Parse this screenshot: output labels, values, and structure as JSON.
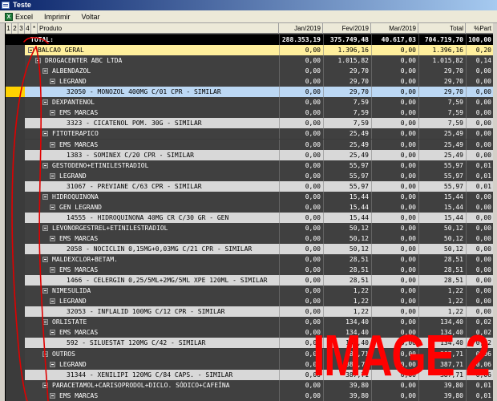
{
  "window": {
    "title": "Teste"
  },
  "menu": {
    "excel": "Excel",
    "imprimir": "Imprimir",
    "voltar": "Voltar",
    "excel_icon": "X"
  },
  "grid": {
    "levels": [
      "1",
      "2",
      "3",
      "4"
    ],
    "header": {
      "star": "*",
      "produto": "Produto",
      "jan": "Jan/2019",
      "fev": "Fev/2019",
      "mar": "Mar/2019",
      "total": "Total",
      "part": "%Part"
    },
    "rows": [
      {
        "type": "total",
        "indent": 0,
        "code": "",
        "label": "TOTAL:",
        "jan": "288.353,19",
        "fev": "375.749,48",
        "mar": "40.617,03",
        "total": "704.719,70",
        "part": "100,00"
      },
      {
        "type": "top",
        "indent": 0,
        "code": "",
        "label": "BALCAO GERAL",
        "jan": "0,00",
        "fev": "1.396,16",
        "mar": "0,00",
        "total": "1.396,16",
        "part": "0,20"
      },
      {
        "type": "group",
        "indent": 1,
        "code": "",
        "label": "DROGACENTER ABC LTDA",
        "jan": "0,00",
        "fev": "1.015,82",
        "mar": "0,00",
        "total": "1.015,82",
        "part": "0,14"
      },
      {
        "type": "group",
        "indent": 2,
        "code": "",
        "label": "ALBENDAZOL",
        "jan": "0,00",
        "fev": "29,70",
        "mar": "0,00",
        "total": "29,70",
        "part": "0,00"
      },
      {
        "type": "group",
        "indent": 3,
        "code": "",
        "label": "LEGRAND",
        "jan": "0,00",
        "fev": "29,70",
        "mar": "0,00",
        "total": "29,70",
        "part": "0,00"
      },
      {
        "type": "selected",
        "indent": 4,
        "code": "32050",
        "label": "- MONOZOL 400MG C/01 CPR - SIMILAR",
        "jan": "0,00",
        "fev": "29,70",
        "mar": "0,00",
        "total": "29,70",
        "part": "0,00"
      },
      {
        "type": "group",
        "indent": 2,
        "code": "",
        "label": "DEXPANTENOL",
        "jan": "0,00",
        "fev": "7,59",
        "mar": "0,00",
        "total": "7,59",
        "part": "0,00"
      },
      {
        "type": "group",
        "indent": 3,
        "code": "",
        "label": "EMS MARCAS",
        "jan": "0,00",
        "fev": "7,59",
        "mar": "0,00",
        "total": "7,59",
        "part": "0,00"
      },
      {
        "type": "product",
        "indent": 4,
        "code": "3323",
        "label": "- CICATENOL POM. 30G - SIMILAR",
        "jan": "0,00",
        "fev": "7,59",
        "mar": "0,00",
        "total": "7,59",
        "part": "0,00"
      },
      {
        "type": "group",
        "indent": 2,
        "code": "",
        "label": "FITOTERAPICO",
        "jan": "0,00",
        "fev": "25,49",
        "mar": "0,00",
        "total": "25,49",
        "part": "0,00"
      },
      {
        "type": "group",
        "indent": 3,
        "code": "",
        "label": "EMS MARCAS",
        "jan": "0,00",
        "fev": "25,49",
        "mar": "0,00",
        "total": "25,49",
        "part": "0,00"
      },
      {
        "type": "product",
        "indent": 4,
        "code": "1383",
        "label": "- SOMINEX C/20 CPR - SIMILAR",
        "jan": "0,00",
        "fev": "25,49",
        "mar": "0,00",
        "total": "25,49",
        "part": "0,00"
      },
      {
        "type": "group",
        "indent": 2,
        "code": "",
        "label": "GESTODENO+ETINILESTRADIOL",
        "jan": "0,00",
        "fev": "55,97",
        "mar": "0,00",
        "total": "55,97",
        "part": "0,01"
      },
      {
        "type": "group",
        "indent": 3,
        "code": "",
        "label": "LEGRAND",
        "jan": "0,00",
        "fev": "55,97",
        "mar": "0,00",
        "total": "55,97",
        "part": "0,01"
      },
      {
        "type": "product",
        "indent": 4,
        "code": "31067",
        "label": "- PREVIANE C/63 CPR - SIMILAR",
        "jan": "0,00",
        "fev": "55,97",
        "mar": "0,00",
        "total": "55,97",
        "part": "0,01"
      },
      {
        "type": "group",
        "indent": 2,
        "code": "",
        "label": "HIDROQUINONA",
        "jan": "0,00",
        "fev": "15,44",
        "mar": "0,00",
        "total": "15,44",
        "part": "0,00"
      },
      {
        "type": "group",
        "indent": 3,
        "code": "",
        "label": "GEN LEGRAND",
        "jan": "0,00",
        "fev": "15,44",
        "mar": "0,00",
        "total": "15,44",
        "part": "0,00"
      },
      {
        "type": "product",
        "indent": 4,
        "code": "14555",
        "label": "- HIDROQUINONA 40MG CR C/30 GR - GEN",
        "jan": "0,00",
        "fev": "15,44",
        "mar": "0,00",
        "total": "15,44",
        "part": "0,00"
      },
      {
        "type": "group",
        "indent": 2,
        "code": "",
        "label": "LEVONORGESTREL+ETINILESTRADIOL",
        "jan": "0,00",
        "fev": "50,12",
        "mar": "0,00",
        "total": "50,12",
        "part": "0,00"
      },
      {
        "type": "group",
        "indent": 3,
        "code": "",
        "label": "EMS MARCAS",
        "jan": "0,00",
        "fev": "50,12",
        "mar": "0,00",
        "total": "50,12",
        "part": "0,00"
      },
      {
        "type": "product",
        "indent": 4,
        "code": "2058",
        "label": "- NOCICLIN 0,15MG+0,03MG C/21 CPR - SIMILAR",
        "jan": "0,00",
        "fev": "50,12",
        "mar": "0,00",
        "total": "50,12",
        "part": "0,00"
      },
      {
        "type": "group",
        "indent": 2,
        "code": "",
        "label": "MALDEXCLOR+BETAM.",
        "jan": "0,00",
        "fev": "28,51",
        "mar": "0,00",
        "total": "28,51",
        "part": "0,00"
      },
      {
        "type": "group",
        "indent": 3,
        "code": "",
        "label": "EMS MARCAS",
        "jan": "0,00",
        "fev": "28,51",
        "mar": "0,00",
        "total": "28,51",
        "part": "0,00"
      },
      {
        "type": "product",
        "indent": 4,
        "code": "1466",
        "label": "- CELERGIN 0,25/5ML+2MG/5ML XPE 120ML - SIMILAR",
        "jan": "0,00",
        "fev": "28,51",
        "mar": "0,00",
        "total": "28,51",
        "part": "0,00"
      },
      {
        "type": "group",
        "indent": 2,
        "code": "",
        "label": "NIMESULIDA",
        "jan": "0,00",
        "fev": "1,22",
        "mar": "0,00",
        "total": "1,22",
        "part": "0,00"
      },
      {
        "type": "group",
        "indent": 3,
        "code": "",
        "label": "LEGRAND",
        "jan": "0,00",
        "fev": "1,22",
        "mar": "0,00",
        "total": "1,22",
        "part": "0,00"
      },
      {
        "type": "product",
        "indent": 4,
        "code": "32053",
        "label": "- INFLALID 100MG C/12 CPR - SIMILAR",
        "jan": "0,00",
        "fev": "1,22",
        "mar": "0,00",
        "total": "1,22",
        "part": "0,00"
      },
      {
        "type": "group",
        "indent": 2,
        "code": "",
        "label": "ORLISTATE",
        "jan": "0,00",
        "fev": "134,40",
        "mar": "0,00",
        "total": "134,40",
        "part": "0,02"
      },
      {
        "type": "group",
        "indent": 3,
        "code": "",
        "label": "EMS MARCAS",
        "jan": "0,00",
        "fev": "134,40",
        "mar": "0,00",
        "total": "134,40",
        "part": "0,02"
      },
      {
        "type": "product",
        "indent": 4,
        "code": "592",
        "label": "- SILUESTAT 120MG C/42 - SIMILAR",
        "jan": "0,00",
        "fev": "134,40",
        "mar": "0,00",
        "total": "134,40",
        "part": "0,02"
      },
      {
        "type": "group",
        "indent": 2,
        "code": "",
        "label": "OUTROS",
        "jan": "0,00",
        "fev": "387,71",
        "mar": "0,00",
        "total": "387,71",
        "part": "0,06"
      },
      {
        "type": "group",
        "indent": 3,
        "code": "",
        "label": "LEGRAND",
        "jan": "0,00",
        "fev": "387,71",
        "mar": "0,00",
        "total": "387,71",
        "part": "0,06"
      },
      {
        "type": "product",
        "indent": 4,
        "code": "31344",
        "label": "- XENILIPI 120MG C/84 CAPS. - SIMILAR",
        "jan": "0,00",
        "fev": "387,71",
        "mar": "0,00",
        "total": "387,71",
        "part": "0,06"
      },
      {
        "type": "group",
        "indent": 2,
        "code": "",
        "label": "PARACETAMOL+CARISOPRODOL+DICLO. SÓDICO+CAFEÍNA",
        "jan": "0,00",
        "fev": "39,80",
        "mar": "0,00",
        "total": "39,80",
        "part": "0,01"
      },
      {
        "type": "group",
        "indent": 3,
        "code": "",
        "label": "EMS MARCAS",
        "jan": "0,00",
        "fev": "39,80",
        "mar": "0,00",
        "total": "39,80",
        "part": "0,01"
      }
    ]
  },
  "watermark": {
    "text": "IMAGE 2",
    "color": "#ff0000"
  }
}
